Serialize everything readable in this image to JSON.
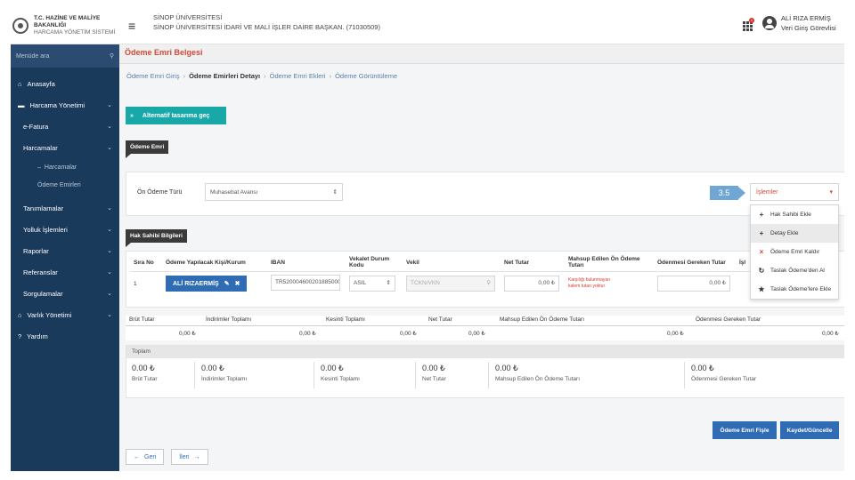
{
  "header": {
    "logo_line1": "T.C. HAZİNE VE MALİYE BAKANLIĞI",
    "logo_line2": "HARCAMA YÖNETİM SİSTEMİ",
    "org_line1": "SİNOP ÜNİVERSİTESİ",
    "org_line2": "SİNOP ÜNİVERSİTESİ İDARİ VE MALİ İŞLER DAİRE BAŞKAN. (71030509)",
    "notification_count": "1",
    "user_name": "ALİ RIZA ERMİŞ",
    "user_role": "Veri Giriş Görevlisi"
  },
  "sidebar": {
    "search_placeholder": "Menüde ara",
    "items": [
      {
        "label": "Anasayfa"
      },
      {
        "label": "Harcama Yönetimi"
      },
      {
        "label": "e-Fatura"
      },
      {
        "label": "Harcamalar"
      },
      {
        "label": "Harcamalar"
      },
      {
        "label": "Ödeme Emirleri"
      },
      {
        "label": "Tanımlamalar"
      },
      {
        "label": "Yolluk İşlemleri"
      },
      {
        "label": "Raporlar"
      },
      {
        "label": "Referanslar"
      },
      {
        "label": "Sorgulamalar"
      },
      {
        "label": "Varlık Yönetimi"
      },
      {
        "label": "Yardım"
      }
    ]
  },
  "page": {
    "title": "Ödeme Emri Belgesi",
    "breadcrumb": [
      "Ödeme Emri Giriş",
      "Ödeme Emirleri Detayı",
      "Ödeme Emri Ekleri",
      "Ödeme Görüntüleme"
    ],
    "alt_design_button": "Alternatif tasarıma geç",
    "section_odeme_emri": "Ödeme Emri",
    "on_odeme_label": "Ön Ödeme Türü",
    "on_odeme_value": "Muhasebat Avansı",
    "islemler_label": "İşlemler",
    "callout": "3.5",
    "dropdown": [
      {
        "icon": "+",
        "label": "Hak Sahibi Ekle"
      },
      {
        "icon": "+",
        "label": "Detay Ekle"
      },
      {
        "icon": "×",
        "label": "Ödeme Emri Kaldır"
      },
      {
        "icon": "↻",
        "label": "Taslak Ödeme'den Al"
      },
      {
        "icon": "★",
        "label": "Taslak Ödeme'lere Ekle"
      }
    ],
    "section_hak_sahibi": "Hak Sahibi Bilgileri"
  },
  "beneficiary_table": {
    "headers": [
      "Sıra No",
      "Ödeme Yapılacak Kişi/Kurum",
      "IBAN",
      "Vekalet Durum Kodu",
      "Vekil",
      "Net Tutar",
      "Mahsup Edilen Ön Ödeme Tutarı",
      "Ödenmesi Gereken Tutar",
      "İşl"
    ],
    "row": {
      "no": "1",
      "person": "ALİ RIZAERMİŞ",
      "iban": "TR520004600201885000",
      "vekalet": "ASIL",
      "vekil_placeholder": "TCKN/VKN",
      "net": "0,00 ₺",
      "mahsup_note_1": "Karşılığı bulunmayan",
      "mahsup_note_2": "kalem tutarı yoktur",
      "odenmesi": "0,00 ₺"
    }
  },
  "summary": {
    "headers": [
      "Brüt Tutar",
      "İndirimler Toplamı",
      "Kesinti Toplamı",
      "Net Tutar",
      "Mahsup Edilen Ön Ödeme Tutarı",
      "Ödenmesi Gereken Tutar"
    ],
    "values": [
      "0,00 ₺",
      "0,00 ₺",
      "0,00 ₺",
      "0,00 ₺",
      "0,00 ₺",
      "0,00 ₺"
    ]
  },
  "totals": {
    "header": "Toplam",
    "items": [
      {
        "value": "0.00 ₺",
        "label": "Brüt Tutar"
      },
      {
        "value": "0.00 ₺",
        "label": "İndirimler Toplamı"
      },
      {
        "value": "0.00 ₺",
        "label": "Kesinti Toplamı"
      },
      {
        "value": "0.00 ₺",
        "label": "Net Tutar"
      },
      {
        "value": "0.00 ₺",
        "label": "Mahsup Edilen Ön Ödeme Tutarı"
      },
      {
        "value": "0.00 ₺",
        "label": "Ödenmesi Gereken Tutar"
      }
    ]
  },
  "actions": {
    "odeme_fisi": "Ödeme Emri Fişle",
    "kaydet": "Kaydet/Güncelle",
    "back": "Geri",
    "next": "İleri"
  },
  "colors": {
    "sidebar_bg": "#1a3a5c",
    "accent_teal": "#19a8a8",
    "primary_blue": "#2f6cb3",
    "title_red": "#d04a3a"
  }
}
